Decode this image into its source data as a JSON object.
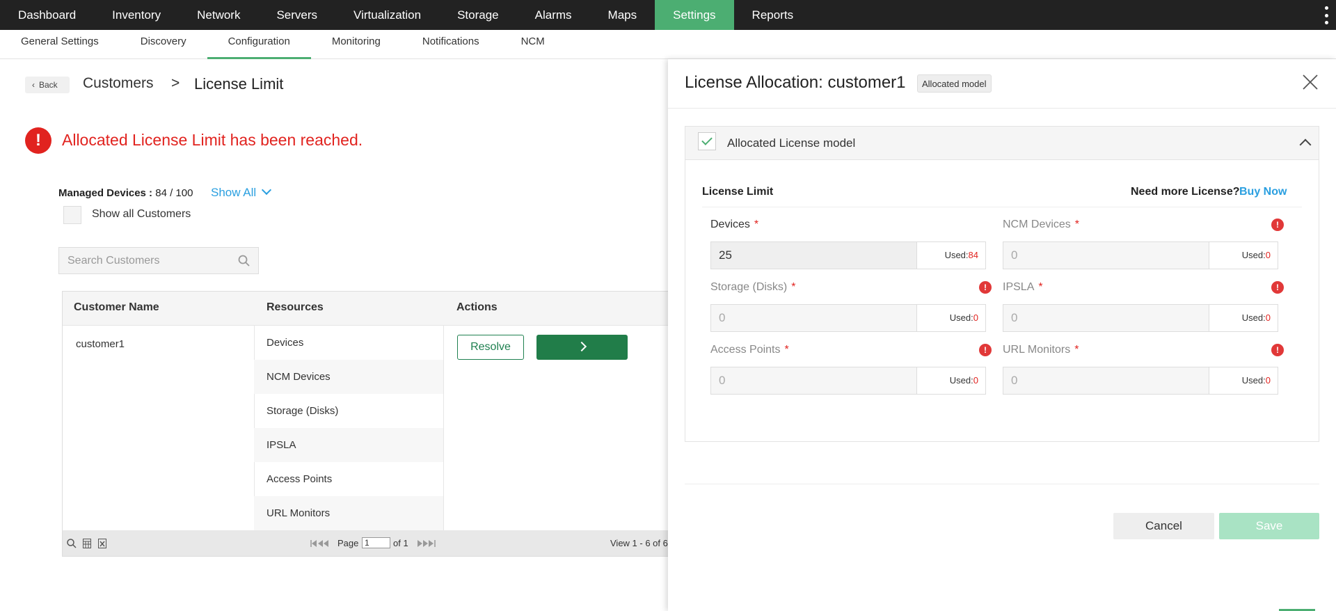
{
  "topnav": {
    "items": [
      "Dashboard",
      "Inventory",
      "Network",
      "Servers",
      "Virtualization",
      "Storage",
      "Alarms",
      "Maps",
      "Settings",
      "Reports"
    ],
    "active": "Settings"
  },
  "subnav": {
    "items": [
      "General Settings",
      "Discovery",
      "Configuration",
      "Monitoring",
      "Notifications",
      "NCM"
    ],
    "active": "Configuration"
  },
  "breadcrumb": {
    "back": "Back",
    "parent": "Customers",
    "separator": ">",
    "current": "License Limit"
  },
  "alert": {
    "icon": "!",
    "message": "Allocated License Limit has been reached."
  },
  "managed": {
    "label": "Managed Devices :",
    "value": "84 / 100",
    "show_all": "Show All"
  },
  "show_all_customers": "Show all Customers",
  "search": {
    "placeholder": "Search Customers"
  },
  "table": {
    "headers": [
      "Customer Name",
      "Resources",
      "Actions"
    ],
    "customer": "customer1",
    "resources": [
      "Devices",
      "NCM Devices",
      "Storage (Disks)",
      "IPSLA",
      "Access Points",
      "URL Monitors"
    ],
    "resolve": "Resolve",
    "pager": {
      "page_label": "Page",
      "page_value": "1",
      "of": "of 1",
      "view": "View 1 - 6 of 6"
    }
  },
  "panel": {
    "title": "License Allocation: customer1",
    "badge": "Allocated model",
    "section_title": "Allocated License model",
    "license_limit": "License Limit",
    "need_more": "Need more License?",
    "buy_now": "Buy Now",
    "used_label": "Used:",
    "fields": [
      {
        "label": "Devices",
        "value": "25",
        "used": "84"
      },
      {
        "label": "NCM Devices",
        "value": "0",
        "used": "0"
      },
      {
        "label": "Storage (Disks)",
        "value": "0",
        "used": "0"
      },
      {
        "label": "IPSLA",
        "value": "0",
        "used": "0"
      },
      {
        "label": "Access Points",
        "value": "0",
        "used": "0"
      },
      {
        "label": "URL Monitors",
        "value": "0",
        "used": "0"
      }
    ],
    "required_mark": "*",
    "error_mark": "!",
    "cancel": "Cancel",
    "save": "Save"
  },
  "colors": {
    "accent": "#4cae72",
    "error": "#e1231f",
    "link": "#2a9fe0",
    "nav_bg": "#222222"
  }
}
